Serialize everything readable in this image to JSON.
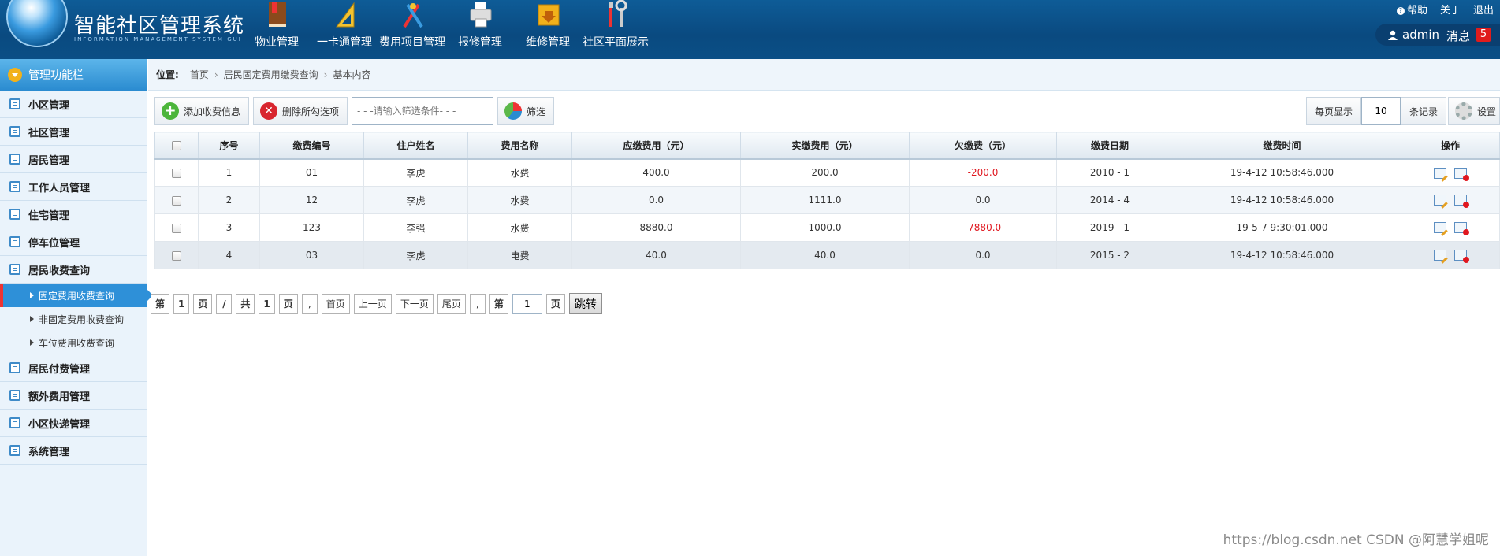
{
  "header": {
    "app_title": "智能社区管理系统",
    "app_subtitle": "INFORMATION MANAGEMENT SYSTEM GUI",
    "nav": [
      {
        "label": "物业管理",
        "icon": "book-icon"
      },
      {
        "label": "一卡通管理",
        "icon": "ruler-icon"
      },
      {
        "label": "费用项目管理",
        "icon": "tools-icon"
      },
      {
        "label": "报修管理",
        "icon": "printer-icon"
      },
      {
        "label": "维修管理",
        "icon": "folder-download-icon"
      },
      {
        "label": "社区平面展示",
        "icon": "wrench-icon"
      }
    ],
    "help": "帮助",
    "about": "关于",
    "logout": "退出",
    "username": "admin",
    "messages": "消息",
    "message_count": "5"
  },
  "sidebar": {
    "title": "管理功能栏",
    "items_top": [
      "小区管理",
      "社区管理",
      "居民管理",
      "工作人员管理",
      "住宅管理",
      "停车位管理",
      "居民收费查询"
    ],
    "sub_items": [
      "固定费用收费查询",
      "非固定费用收费查询",
      "车位费用收费查询"
    ],
    "items_bottom": [
      "居民付费管理",
      "额外费用管理",
      "小区快递管理",
      "系统管理"
    ]
  },
  "breadcrumb": {
    "label": "位置:",
    "items": [
      "首页",
      "居民固定费用缴费查询",
      "基本内容"
    ]
  },
  "toolbar": {
    "add_label": "添加收费信息",
    "delete_label": "删除所勾选项",
    "filter_placeholder": "- - -请输入筛选条件- - -",
    "filter_label": "筛选",
    "per_page_label": "每页显示",
    "per_page_value": "10",
    "records_label": "条记录",
    "settings_label": "设置"
  },
  "table": {
    "headers": [
      "序号",
      "缴费编号",
      "住户姓名",
      "费用名称",
      "应缴费用（元）",
      "实缴费用（元）",
      "欠缴费（元）",
      "缴费日期",
      "缴费时间",
      "操作"
    ],
    "rows": [
      [
        "1",
        "01",
        "李虎",
        "水费",
        "400.0",
        "200.0",
        "-200.0",
        "2010 - 1",
        "19-4-12 10:58:46.000"
      ],
      [
        "2",
        "12",
        "李虎",
        "水费",
        "0.0",
        "1111.0",
        "0.0",
        "2014 - 4",
        "19-4-12 10:58:46.000"
      ],
      [
        "3",
        "123",
        "李强",
        "水费",
        "8880.0",
        "1000.0",
        "-7880.0",
        "2019 - 1",
        "19-5-7 9:30:01.000"
      ],
      [
        "4",
        "03",
        "李虎",
        "电费",
        "40.0",
        "40.0",
        "0.0",
        "2015 - 2",
        "19-4-12 10:58:46.000"
      ]
    ],
    "negative_color": "#e0171f"
  },
  "pager": {
    "page_prefix": "第",
    "current_page": "1",
    "page_suffix": "页",
    "slash": "/",
    "total_prefix": "共",
    "total_pages": "1",
    "total_suffix": "页",
    "comma": ",",
    "first": "首页",
    "prev": "上一页",
    "next": "下一页",
    "last": "尾页",
    "comma2": ",",
    "goto_prefix": "第",
    "goto_value": "1",
    "goto_suffix": "页",
    "jump": "跳转"
  },
  "watermark": "https://blog.csdn.net  CSDN @阿慧学姐呢"
}
